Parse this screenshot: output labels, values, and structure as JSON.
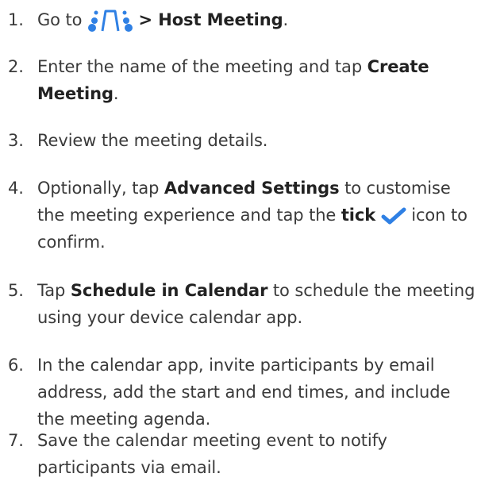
{
  "steps": [
    {
      "num": "1.",
      "go_to": "Go to",
      "icon": "meeting-app-icon",
      "menu_path": "> Host Meeting",
      "end": "."
    },
    {
      "num": "2.",
      "text_a": "Enter the name of the meeting and tap",
      "bold_a": "Create Meeting",
      "end": "."
    },
    {
      "num": "3.",
      "text_a": "Review the meeting details."
    },
    {
      "num": "4.",
      "text_a": "Optionally, tap",
      "bold_a": "Advanced Settings",
      "text_b": "to customise the meeting experience and tap the",
      "bold_b": "tick",
      "icon": "checkmark-icon",
      "text_c": "icon to confirm."
    },
    {
      "num": "5.",
      "text_a": "Tap",
      "bold_a": "Schedule in Calendar",
      "text_b": "to schedule the meeting using your device calendar app."
    },
    {
      "num": "6.",
      "text_a": "In the calendar app, invite participants by email address, add the start and end times, and include the meeting agenda."
    },
    {
      "num": "7.",
      "text_a": "Save the calendar meeting event to notify participants via email."
    }
  ],
  "colors": {
    "text": "#3a3a3a",
    "icon_blue": "#2f80e4",
    "bold": "#222222"
  }
}
